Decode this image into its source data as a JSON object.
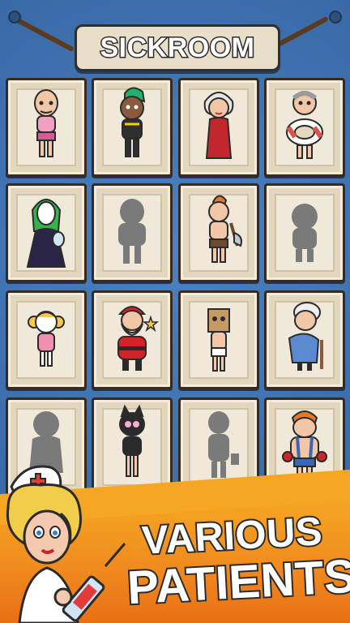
{
  "header": {
    "title": "SICKROOM"
  },
  "grid": {
    "cards": [
      {
        "name": "bald-man"
      },
      {
        "name": "punk-green-mohawk"
      },
      {
        "name": "lady-red-dress"
      },
      {
        "name": "grandpa-lifebuoy"
      },
      {
        "name": "green-hair-woman-mirror"
      },
      {
        "name": "locked-silhouette"
      },
      {
        "name": "axe-man"
      },
      {
        "name": "locked-silhouette"
      },
      {
        "name": "little-girl-pigtails"
      },
      {
        "name": "santa-claus"
      },
      {
        "name": "paper-bag-head"
      },
      {
        "name": "granny-cane"
      },
      {
        "name": "locked-silhouette"
      },
      {
        "name": "cat-mask-lady"
      },
      {
        "name": "locked-silhouette"
      },
      {
        "name": "wrestler-orange-hair"
      }
    ]
  },
  "promo": {
    "line1": "VARIOUS",
    "line2": "PATIENTS"
  },
  "colors": {
    "background": "#3f74b4",
    "promo": "#f08c1f",
    "card": "#e2d6bd"
  }
}
